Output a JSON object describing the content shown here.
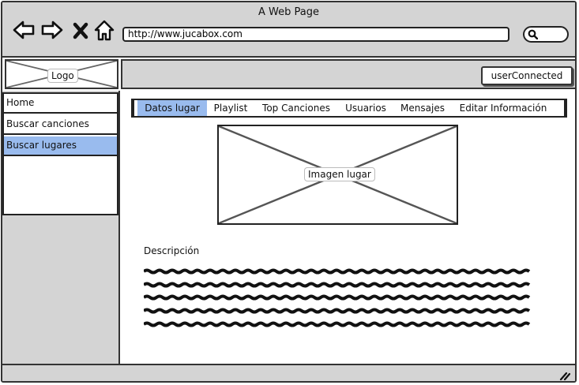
{
  "window": {
    "title": "A Web Page"
  },
  "browser": {
    "url": "http://www.jucabox.com",
    "icons": [
      "back-arrow-icon",
      "forward-arrow-icon",
      "close-x-icon",
      "home-icon",
      "search-icon"
    ]
  },
  "header": {
    "logo_label": "Logo",
    "user_label": "userConnected"
  },
  "sidebar": {
    "items": [
      {
        "label": "Home",
        "selected": false
      },
      {
        "label": "Buscar canciones",
        "selected": false
      },
      {
        "label": "Buscar lugares",
        "selected": true
      }
    ]
  },
  "tabs": [
    {
      "label": "Datos lugar",
      "active": true
    },
    {
      "label": "Playlist",
      "active": false
    },
    {
      "label": "Top Canciones",
      "active": false
    },
    {
      "label": "Usuarios",
      "active": false
    },
    {
      "label": "Mensajes",
      "active": false
    },
    {
      "label": "Editar Información",
      "active": false
    }
  ],
  "main": {
    "image_label": "Imagen lugar",
    "description_title": "Descripción"
  },
  "colors": {
    "selected": "#99bbee",
    "chrome": "#d4d4d4",
    "border": "#333333"
  }
}
